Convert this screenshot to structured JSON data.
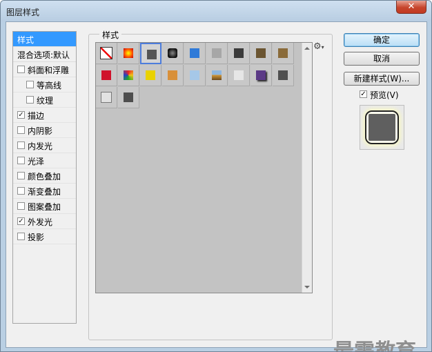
{
  "window": {
    "title": "图层样式",
    "close_glyph": "✕"
  },
  "left_panel": {
    "header_selected": "样式",
    "header_blend": "混合选项:默认",
    "items": [
      {
        "label": "斜面和浮雕",
        "checked": false,
        "indent": false
      },
      {
        "label": "等高线",
        "checked": false,
        "indent": true
      },
      {
        "label": "纹理",
        "checked": false,
        "indent": true
      },
      {
        "label": "描边",
        "checked": true,
        "indent": false
      },
      {
        "label": "内阴影",
        "checked": false,
        "indent": false
      },
      {
        "label": "内发光",
        "checked": false,
        "indent": false
      },
      {
        "label": "光泽",
        "checked": false,
        "indent": false
      },
      {
        "label": "颜色叠加",
        "checked": false,
        "indent": false
      },
      {
        "label": "渐变叠加",
        "checked": false,
        "indent": false
      },
      {
        "label": "图案叠加",
        "checked": false,
        "indent": false
      },
      {
        "label": "外发光",
        "checked": true,
        "indent": false
      },
      {
        "label": "投影",
        "checked": false,
        "indent": false
      }
    ]
  },
  "styles_group": {
    "label": "样式",
    "gear_icon": "gear-icon",
    "swatches": [
      {
        "name": "none-style",
        "color": "#ffffff"
      },
      {
        "name": "orange-glow",
        "color": "#ff5a00"
      },
      {
        "name": "dark-gray-square",
        "color": "#555555",
        "selected": true
      },
      {
        "name": "black-button",
        "color": "#1d1d1d"
      },
      {
        "name": "blue-glass",
        "color": "#2f7ad8"
      },
      {
        "name": "light-gray",
        "color": "#a7a7a7"
      },
      {
        "name": "dark-metal",
        "color": "#3b3b3b"
      },
      {
        "name": "brown-texture",
        "color": "#6b5531"
      },
      {
        "name": "bronze-texture",
        "color": "#8a6b3a"
      },
      {
        "name": "red-bar",
        "color": "#d0122b"
      },
      {
        "name": "rainbow-burst",
        "color": "#f0c419"
      },
      {
        "name": "yellow-gold",
        "color": "#e9d200"
      },
      {
        "name": "orange-gradient",
        "color": "#d8903a"
      },
      {
        "name": "light-blue",
        "color": "#a6c8e8"
      },
      {
        "name": "sky-landscape",
        "color": "#5e84a8"
      },
      {
        "name": "white-marble",
        "color": "#e6e6e6"
      },
      {
        "name": "purple-shadow",
        "color": "#5b3a86"
      },
      {
        "name": "dark-gray-2",
        "color": "#505050"
      },
      {
        "name": "empty-outline",
        "color": "#c8c8c8"
      },
      {
        "name": "dark-gray-3",
        "color": "#4e4e4e"
      }
    ]
  },
  "buttons": {
    "ok": "确定",
    "cancel": "取消",
    "new_style": "新建样式(W)..."
  },
  "preview": {
    "label": "预览(V)",
    "checked": true
  },
  "watermark": "最需教育",
  "colors": {
    "selection": "#3399ff",
    "title_bar": "#b9cfe3",
    "close_button": "#c6452c"
  }
}
